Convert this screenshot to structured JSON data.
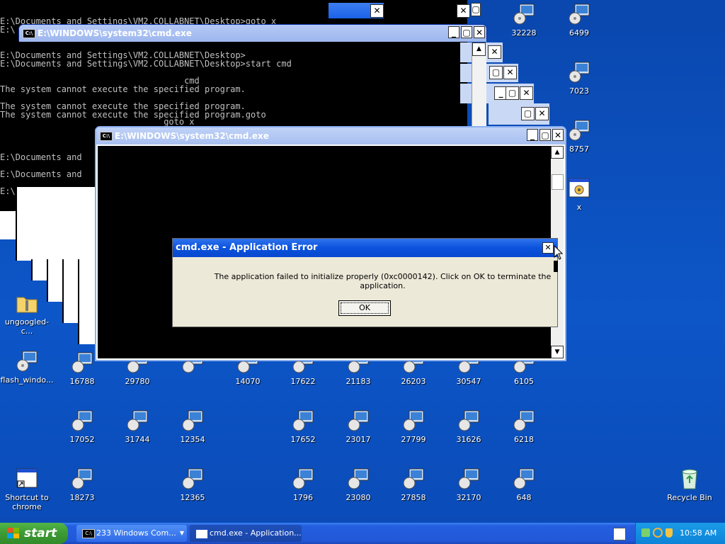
{
  "console_bg": {
    "lines": [
      "E:\\Documents and Settings\\VM2.COLLABNET\\Desktop>goto x",
      "E:\\",
      "",
      "",
      "E:\\Documents and Settings\\VM2.COLLABNET\\Desktop>",
      "E:\\Documents and Settings\\VM2.COLLABNET\\Desktop>start cmd",
      "",
      "                                    cmd",
      "The system cannot execute the specified program.",
      "",
      "The system cannot execute the specified program.",
      "The system cannot execute the specified program.goto",
      "                                goto x",
      "",
      "",
      "E:\\Documents and",
      "",
      "E:\\Documents and",
      "",
      "E:\\"
    ]
  },
  "cmd_window_back": {
    "title": "E:\\WINDOWS\\system32\\cmd.exe"
  },
  "cmd_window_front": {
    "title": "E:\\WINDOWS\\system32\\cmd.exe"
  },
  "dialog": {
    "title": "cmd.exe - Application Error",
    "message": "The application failed to initialize properly (0xc0000142). Click on OK to terminate the application.",
    "ok_label": "OK"
  },
  "desktop_icons_right": [
    {
      "label": "32228"
    },
    {
      "label": "6499"
    },
    {
      "label": "7023"
    },
    {
      "label": "8757"
    },
    {
      "label": "x"
    }
  ],
  "desktop_icons_left": [
    {
      "label": "ungoogled-c..."
    },
    {
      "label": "flash_windo..."
    },
    {
      "label": "Shortcut to chrome"
    }
  ],
  "desktop_row1": [
    "16788",
    "29780",
    "",
    "14070",
    "17622",
    "21183",
    "26203",
    "30547",
    "6105"
  ],
  "desktop_row2": [
    "17052",
    "31744",
    "12354",
    "17652",
    "23017",
    "27799",
    "31626",
    "6218"
  ],
  "desktop_row3": [
    "18273",
    "12365",
    "1796",
    "23080",
    "27858",
    "32170",
    "648"
  ],
  "recycle_bin": {
    "label": "Recycle Bin"
  },
  "taskbar": {
    "start_label": "start",
    "buttons": [
      {
        "label": "233 Windows Com..."
      },
      {
        "label": "cmd.exe - Application..."
      }
    ],
    "clock": "10:58 AM"
  },
  "colors": {
    "desktop": "#0c4db5",
    "titlebar": "#0a55e2",
    "close": "#c43b19",
    "dialog_bg": "#ece9d8"
  }
}
